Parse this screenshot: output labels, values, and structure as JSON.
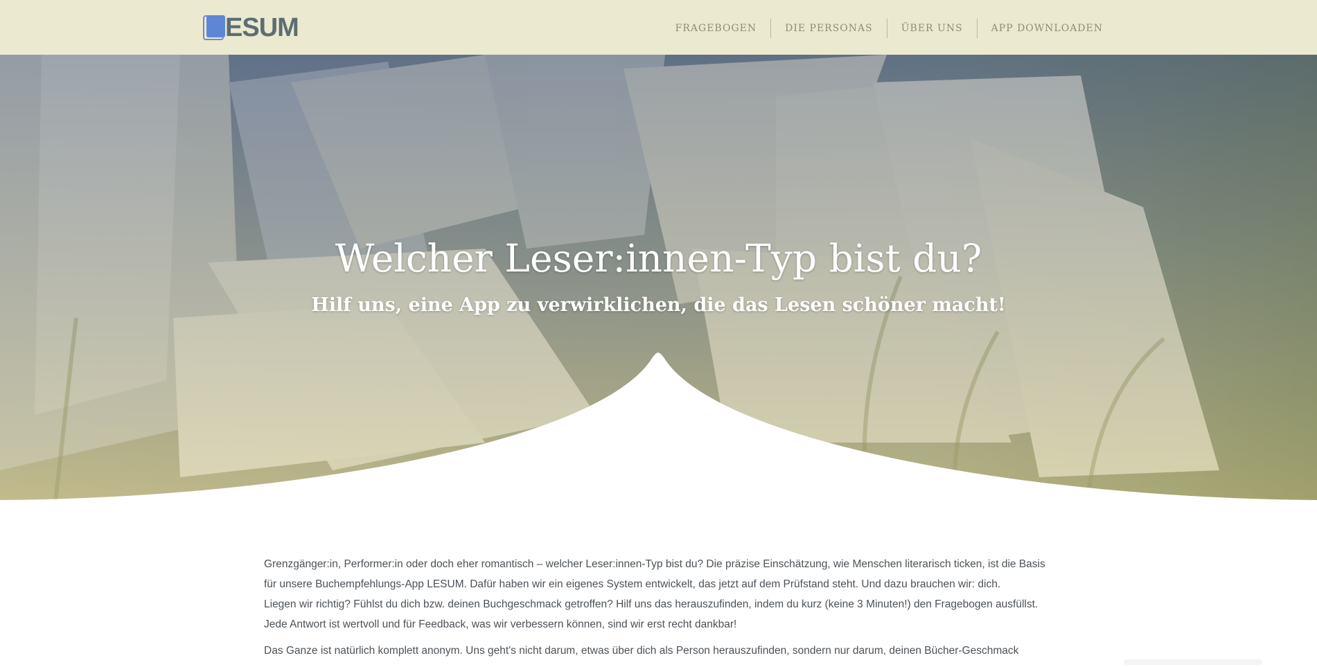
{
  "header": {
    "logo_text": "ESUM",
    "nav": [
      {
        "label": "FRAGEBOGEN"
      },
      {
        "label": "DIE PERSONAS"
      },
      {
        "label": "ÜBER UNS"
      },
      {
        "label": "APP DOWNLOADEN"
      }
    ]
  },
  "hero": {
    "title": "Welcher Leser:innen-Typ bist du?",
    "subtitle": "Hilf uns, eine App zu verwirklichen, die das Lesen schöner macht!"
  },
  "content": {
    "paragraph_1": "Grenzgänger:in, Performer:in oder doch eher romantisch – welcher Leser:innen-Typ bist du? Die präzise Einschätzung, wie Menschen literarisch ticken, ist die Basis für unsere Buchempfehlungs-App LESUM. Dafür haben wir ein eigenes System entwickelt, das jetzt auf dem Prüfstand steht. Und dazu brauchen wir: dich.",
    "paragraph_1b": "Liegen wir richtig? Fühlst du dich bzw. deinen Buchgeschmack getroffen? Hilf uns das herauszufinden, indem du kurz (keine 3 Minuten!) den Fragebogen ausfüllst. Jede Antwort ist wertvoll und für Feedback, was wir verbessern können, sind wir erst recht dankbar!",
    "paragraph_2": "Das Ganze ist natürlich komplett anonym. Uns geht's nicht darum, etwas über dich als Person herauszufinden, sondern nur darum, deinen Bücher-Geschmack"
  },
  "colors": {
    "header_bg": "#ebe9cf",
    "nav_text": "#8f8d78",
    "logo_blue": "#5f86d6",
    "logo_text": "#5b6e73",
    "body_text": "#4c5258"
  }
}
